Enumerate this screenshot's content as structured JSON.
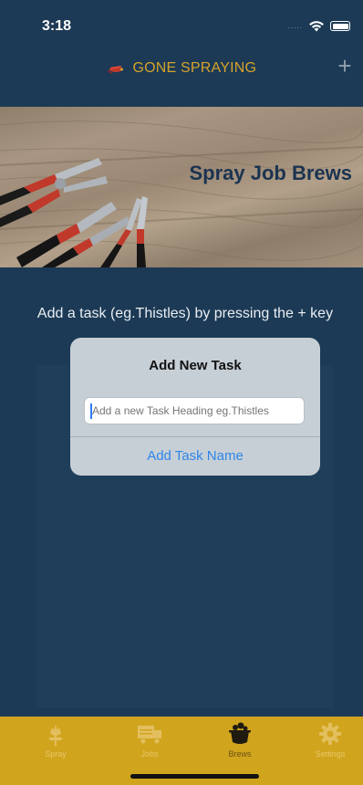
{
  "status_bar": {
    "time": "3:18",
    "signal": "....."
  },
  "navbar": {
    "title": "GONE SPRAYING",
    "add_icon": "plus-icon"
  },
  "hero": {
    "title": "Spray Job Brews"
  },
  "hint": "Add a task (eg.Thistles) by pressing the + key",
  "dialog": {
    "title": "Add New Task",
    "input_placeholder": "Add a new Task Heading eg.Thistles",
    "input_value": "",
    "button_label": "Add Task Name"
  },
  "tabs": [
    {
      "label": "Spray",
      "icon": "thistle-icon",
      "active": false
    },
    {
      "label": "Jobs",
      "icon": "truck-icon",
      "active": false
    },
    {
      "label": "Brews",
      "icon": "cauldron-icon",
      "active": true
    },
    {
      "label": "Settings",
      "icon": "gear-icon",
      "active": false
    }
  ],
  "colors": {
    "background": "#1c3a55",
    "accent": "#d6a22b",
    "tabbar": "#d1a41e",
    "link": "#2f86e8"
  }
}
